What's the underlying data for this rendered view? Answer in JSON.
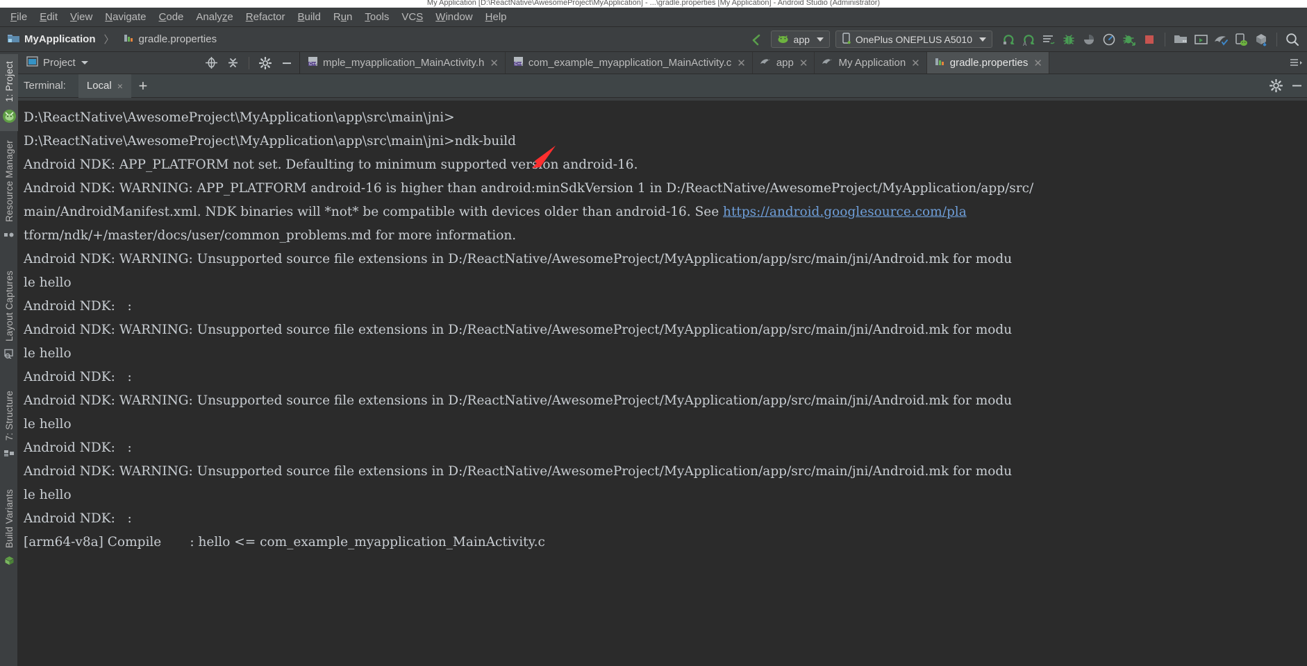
{
  "window": {
    "title": "My Application [D:\\ReactNative\\AwesomeProject\\MyApplication] - ...\\gradle.properties [My Application] - Android Studio (Administrator)"
  },
  "menubar": {
    "items": [
      {
        "label": "File",
        "mnemonic": "F"
      },
      {
        "label": "Edit",
        "mnemonic": "E"
      },
      {
        "label": "View",
        "mnemonic": "V"
      },
      {
        "label": "Navigate",
        "mnemonic": "N"
      },
      {
        "label": "Code",
        "mnemonic": "C"
      },
      {
        "label": "Analyze",
        "mnemonic": "z"
      },
      {
        "label": "Refactor",
        "mnemonic": "R"
      },
      {
        "label": "Build",
        "mnemonic": "B"
      },
      {
        "label": "Run",
        "mnemonic": "u"
      },
      {
        "label": "Tools",
        "mnemonic": "T"
      },
      {
        "label": "VCS",
        "mnemonic": "S"
      },
      {
        "label": "Window",
        "mnemonic": "W"
      },
      {
        "label": "Help",
        "mnemonic": "H"
      }
    ]
  },
  "navbar": {
    "breadcrumb": [
      {
        "label": "MyApplication",
        "icon": "project-folder-icon"
      },
      {
        "label": "gradle.properties",
        "icon": "gradle-file-icon"
      }
    ],
    "separator": "〉",
    "run_config": {
      "label": "app",
      "icon": "android-head-icon"
    },
    "device": {
      "label": "OnePlus ONEPLUS A5010",
      "icon": "phone-icon"
    },
    "toolbar_icons": [
      "run-icon",
      "run-with-coverage-icon",
      "logcat-icon",
      "debug-bug-icon",
      "coverage-icon",
      "profiler-icon",
      "attach-debugger-icon",
      "stop-icon",
      "sdk-manager-icon",
      "avd-manager-icon",
      "gradle-sync-icon",
      "device-file-explorer-icon",
      "layout-inspector-icon",
      "search-everywhere-icon"
    ]
  },
  "project_panel": {
    "title": "Project",
    "icons": [
      "locate-icon",
      "collapse-all-icon",
      "settings-gear-icon",
      "hide-icon"
    ]
  },
  "editor_tabs": [
    {
      "label": "mple_myapplication_MainActivity.h",
      "icon": "c-header-icon",
      "active": false
    },
    {
      "label": "com_example_myapplication_MainActivity.c",
      "icon": "c-source-icon",
      "active": false
    },
    {
      "label": "app",
      "icon": "gradle-icon",
      "active": false
    },
    {
      "label": "My Application",
      "icon": "gradle-icon",
      "active": false
    },
    {
      "label": "gradle.properties",
      "icon": "gradle-file-icon",
      "active": true
    }
  ],
  "terminal": {
    "label": "Terminal:",
    "tab": {
      "label": "Local",
      "close": "×"
    },
    "add_button": "+",
    "header_icons": [
      "settings-gear-icon",
      "minimize-icon"
    ],
    "lines": [
      {
        "segments": [
          {
            "text": "D:\\ReactNative\\AwesomeProject\\MyApplication\\app\\src\\main\\jni>",
            "kind": "text"
          }
        ]
      },
      {
        "segments": [
          {
            "text": "D:\\ReactNative\\AwesomeProject\\MyApplication\\app\\src\\main\\jni>ndk-build",
            "kind": "text"
          }
        ]
      },
      {
        "segments": [
          {
            "text": "Android NDK: APP_PLATFORM not set. Defaulting to minimum supported version android-16.",
            "kind": "text"
          }
        ]
      },
      {
        "segments": [
          {
            "text": "Android NDK: WARNING: APP_PLATFORM android-16 is higher than android:minSdkVersion 1 in D:/ReactNative/AwesomeProject/MyApplication/app/src/",
            "kind": "text"
          }
        ]
      },
      {
        "segments": [
          {
            "text": "main/AndroidManifest.xml. NDK binaries will *not* be compatible with devices older than android-16. See ",
            "kind": "text"
          },
          {
            "text": "https://android.googlesource.com/pla",
            "kind": "link"
          }
        ]
      },
      {
        "segments": [
          {
            "text": "tform/ndk/+/master/docs/user/common_problems.md for more information.",
            "kind": "text"
          }
        ]
      },
      {
        "segments": [
          {
            "text": "Android NDK: WARNING: Unsupported source file extensions in D:/ReactNative/AwesomeProject/MyApplication/app/src/main/jni/Android.mk for modu",
            "kind": "text"
          }
        ]
      },
      {
        "segments": [
          {
            "text": "le hello",
            "kind": "text"
          }
        ]
      },
      {
        "segments": [
          {
            "text": "Android NDK:   :",
            "kind": "text"
          }
        ]
      },
      {
        "segments": [
          {
            "text": "Android NDK: WARNING: Unsupported source file extensions in D:/ReactNative/AwesomeProject/MyApplication/app/src/main/jni/Android.mk for modu",
            "kind": "text"
          }
        ]
      },
      {
        "segments": [
          {
            "text": "le hello",
            "kind": "text"
          }
        ]
      },
      {
        "segments": [
          {
            "text": "Android NDK:   :",
            "kind": "text"
          }
        ]
      },
      {
        "segments": [
          {
            "text": "Android NDK: WARNING: Unsupported source file extensions in D:/ReactNative/AwesomeProject/MyApplication/app/src/main/jni/Android.mk for modu",
            "kind": "text"
          }
        ]
      },
      {
        "segments": [
          {
            "text": "le hello",
            "kind": "text"
          }
        ]
      },
      {
        "segments": [
          {
            "text": "Android NDK:   :",
            "kind": "text"
          }
        ]
      },
      {
        "segments": [
          {
            "text": "Android NDK: WARNING: Unsupported source file extensions in D:/ReactNative/AwesomeProject/MyApplication/app/src/main/jni/Android.mk for modu",
            "kind": "text"
          }
        ]
      },
      {
        "segments": [
          {
            "text": "le hello",
            "kind": "text"
          }
        ]
      },
      {
        "segments": [
          {
            "text": "Android NDK:   :",
            "kind": "text"
          }
        ]
      },
      {
        "segments": [
          {
            "text": "[arm64-v8a] Compile       : hello <= com_example_myapplication_MainActivity.c",
            "kind": "text"
          }
        ]
      }
    ]
  },
  "left_strip": {
    "top_items": [
      {
        "label": "1: Project",
        "active": true
      }
    ],
    "items": [
      {
        "label": "Resource Manager",
        "icon": "resource-manager-icon"
      },
      {
        "label": "Layout Captures",
        "icon": "layout-captures-icon"
      },
      {
        "label": "7: Structure",
        "icon": "structure-icon"
      },
      {
        "label": "Build Variants",
        "icon": "build-variants-icon"
      }
    ],
    "android_icon": "android-robot-icon"
  },
  "colors": {
    "background": "#3c3f41",
    "terminal_bg": "#2b2b2b",
    "terminal_fg": "#c8cdd2",
    "link": "#6e9ed8",
    "accent_green": "#499c54",
    "accent_red": "#c75450",
    "annotation": "#ff2f2f"
  },
  "annotation": {
    "type": "red-arrow",
    "points_to": "ndk-build"
  }
}
